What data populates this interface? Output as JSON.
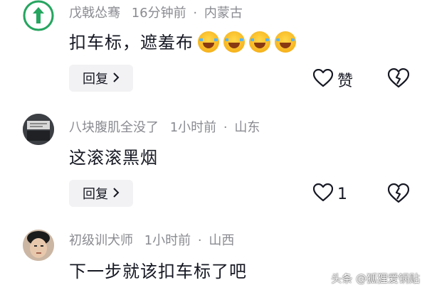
{
  "comments": [
    {
      "author": "戊戟怂骞",
      "time": "16分钟前",
      "location": "内蒙古",
      "text": "扣车标，遮羞布",
      "emoji_icons": [
        "laughing-crying-emoji-icon",
        "laughing-crying-emoji-icon",
        "laughing-crying-emoji-icon",
        "laughing-crying-emoji-icon"
      ],
      "reply_label": "回复",
      "like_label": "赞"
    },
    {
      "author": "八块腹肌全没了",
      "time": "1小时前",
      "location": "山东",
      "text": "这滚滚黑烟",
      "reply_label": "回复",
      "like_label": "1"
    },
    {
      "author": "初级训犬师",
      "time": "1小时前",
      "location": "山西",
      "text": "下一步就该扣车标了吧"
    }
  ],
  "separator": "·",
  "watermark": "头条 @狐狸爱锅贴",
  "colors": {
    "meta_gray": "#8a8b91",
    "text_dark": "#161823",
    "reply_bg": "#f2f2f4",
    "avatar1_green": "#25a55f"
  }
}
